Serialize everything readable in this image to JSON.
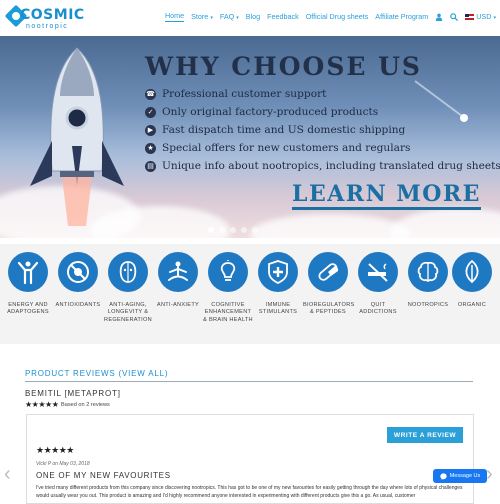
{
  "logo": {
    "name": "COSMIC",
    "sub": "nootropic"
  },
  "nav": {
    "items": [
      {
        "label": "Home",
        "active": true,
        "caret": false
      },
      {
        "label": "Store",
        "active": false,
        "caret": true
      },
      {
        "label": "FAQ",
        "active": false,
        "caret": true
      },
      {
        "label": "Blog",
        "active": false,
        "caret": false
      },
      {
        "label": "Feedback",
        "active": false,
        "caret": false
      },
      {
        "label": "Official Drug sheets",
        "active": false,
        "caret": false
      },
      {
        "label": "Affiliate Program",
        "active": false,
        "caret": false
      }
    ],
    "currency": "USD",
    "icons": [
      "user-icon",
      "search-icon"
    ]
  },
  "hero": {
    "title": "WHY CHOOSE US",
    "features": [
      "Professional customer support",
      "Only original factory-produced products",
      "Fast dispatch time and US domestic shipping",
      "Special offers for new customers and regulars",
      "Unique info about nootropics, including translated drug sheets"
    ],
    "cta": "LEARN MORE",
    "slide_count": 5,
    "active_slide": 0
  },
  "categories": [
    {
      "label": "ENERGY AND ADAPTOGENS",
      "icon": "person-arms-up-icon"
    },
    {
      "label": "ANTIOXIDANTS",
      "icon": "no-virus-icon"
    },
    {
      "label": "ANTI-AGING, LONGEVITY & REGENERATION",
      "icon": "face-icon"
    },
    {
      "label": "ANTI-ANXIETY",
      "icon": "meditation-icon"
    },
    {
      "label": "COGNITIVE ENHANCEMENT & BRAIN HEALTH",
      "icon": "lightbulb-icon"
    },
    {
      "label": "IMMUNE STIMULANTS",
      "icon": "shield-cross-icon"
    },
    {
      "label": "BIOREGULATORS & PEPTIDES",
      "icon": "capsule-icon"
    },
    {
      "label": "QUIT ADDICTIONS",
      "icon": "no-smoking-icon"
    },
    {
      "label": "NOOTROPICS",
      "icon": "brain-icon"
    },
    {
      "label": "ORGANIC",
      "icon": "leaf-icon"
    }
  ],
  "reviews": {
    "heading": "PRODUCT REVIEWS (VIEW ALL)",
    "product": "BEMITIL [METAPROT]",
    "stars": 5,
    "based_on": "Based on 2 reviews",
    "write_button": "WRITE A REVIEW",
    "review": {
      "stars": 5,
      "author_date": "Vicki P on May 03, 2018",
      "title": "ONE OF MY NEW FAVOURITES",
      "body": "I've tried many different products from this company since discovering nootropics. This has got to be one of my new favourites for easily getting through the day where lots of physical challenges would usually wear you out. This product is amazing and I'd highly recommend anyone interested in experimenting with different products give this a go. As usual, customer"
    }
  },
  "chat": {
    "label": "Message Us"
  },
  "colors": {
    "brand": "#1a8fd0",
    "category_circle": "#1f78c2",
    "button": "#2a9fd8",
    "messenger": "#1877f2"
  }
}
